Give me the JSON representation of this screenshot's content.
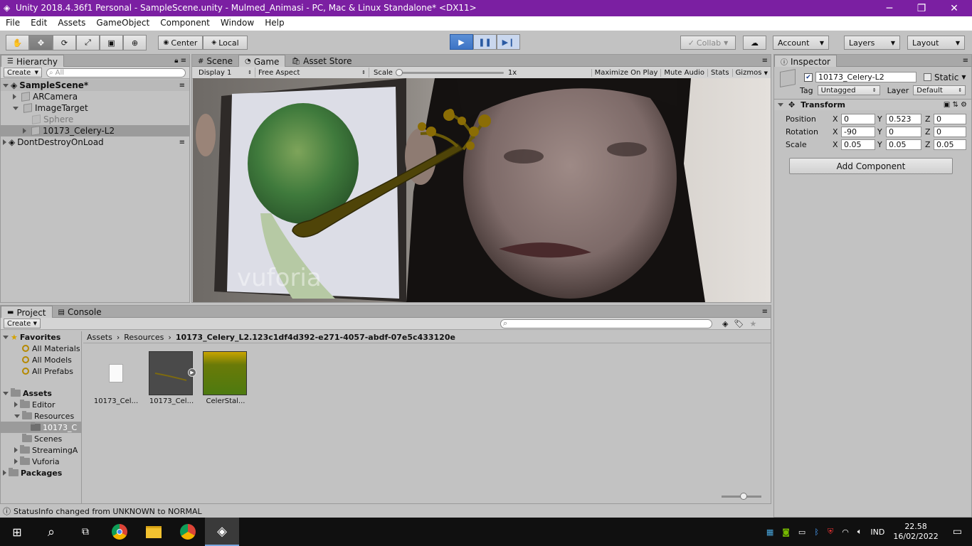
{
  "window": {
    "title": "Unity 2018.4.36f1 Personal - SampleScene.unity - Mulmed_Animasi - PC, Mac & Linux Standalone* <DX11>",
    "minimize": "─",
    "restore": "❐",
    "close": "✕"
  },
  "menu": [
    "File",
    "Edit",
    "Assets",
    "GameObject",
    "Component",
    "Window",
    "Help"
  ],
  "toolbar": {
    "pivot_label": "Center",
    "space_label": "Local",
    "collab_label": "Collab",
    "account_label": "Account",
    "layers_label": "Layers",
    "layout_label": "Layout"
  },
  "hierarchy": {
    "tab": "Hierarchy",
    "create_label": "Create",
    "search_placeholder": "All",
    "scene_name": "SampleScene*",
    "items": [
      "ARCamera",
      "ImageTarget",
      "Sphere",
      "10173_Celery-L2"
    ],
    "dont_destroy": "DontDestroyOnLoad"
  },
  "view_tabs": {
    "scene": "Scene",
    "game": "Game",
    "asset_store": "Asset Store"
  },
  "game_bar": {
    "display": "Display 1",
    "aspect": "Free Aspect",
    "scale_label": "Scale",
    "scale_value": "1x",
    "maximize": "Maximize On Play",
    "mute": "Mute Audio",
    "stats": "Stats",
    "gizmos": "Gizmos"
  },
  "game_view": {
    "watermark": "vuforia"
  },
  "inspector": {
    "tab": "Inspector",
    "object_name": "10173_Celery-L2",
    "static_label": "Static",
    "tag_label": "Tag",
    "tag_value": "Untagged",
    "layer_label": "Layer",
    "layer_value": "Default",
    "transform_label": "Transform",
    "position_label": "Position",
    "rotation_label": "Rotation",
    "scale_label": "Scale",
    "position": {
      "x": "0",
      "y": "0.523",
      "z": "0"
    },
    "rotation": {
      "x": "-90",
      "y": "0",
      "z": "0"
    },
    "scale": {
      "x": "0.05",
      "y": "0.05",
      "z": "0.05"
    },
    "axis_x": "X",
    "axis_y": "Y",
    "axis_z": "Z",
    "add_component": "Add Component"
  },
  "project": {
    "tab_project": "Project",
    "tab_console": "Console",
    "create_label": "Create",
    "favorites_label": "Favorites",
    "favorites": [
      "All Materials",
      "All Models",
      "All Prefabs"
    ],
    "assets_label": "Assets",
    "folders": [
      "Editor",
      "Resources",
      "10173_C",
      "Scenes",
      "StreamingA",
      "Vuforia"
    ],
    "packages_label": "Packages",
    "breadcrumb": [
      "Assets",
      "Resources",
      "10173_Celery_L2.123c1df4d392-e271-4057-abdf-07e5c433120e"
    ],
    "assets": [
      "10173_Cel...",
      "10173_Cel...",
      "CelerStal..."
    ]
  },
  "status": {
    "text": "StatusInfo changed from UNKNOWN to NORMAL"
  },
  "taskbar": {
    "lang": "IND",
    "time": "22.58",
    "date": "16/02/2022"
  },
  "colors": {
    "title_bar": "#7b1fa2",
    "play_blue": "#3d74c5",
    "celery_material": "#4d7a10"
  }
}
